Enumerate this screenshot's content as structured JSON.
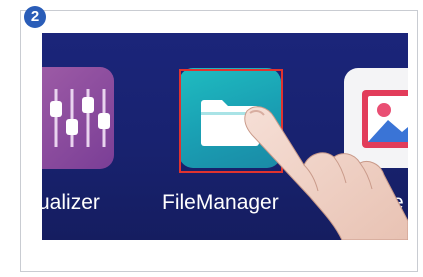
{
  "step": {
    "number": "2"
  },
  "apps": [
    {
      "name": "Equalizer",
      "label": "ualizer",
      "icon": "equalizer-icon"
    },
    {
      "name": "FileManager",
      "label": "FileManager",
      "icon": "folder-icon"
    },
    {
      "name": "Gallery",
      "label": "e",
      "icon": "gallery-icon"
    }
  ],
  "colors": {
    "step_badge": "#2a5db8",
    "screen_background": "#1b257a",
    "highlight_box": "#e0332f",
    "filemanager_icon": "#1fb1bb",
    "equalizer_icon": "#8c4c9f"
  },
  "highlighted_app": "FileManager"
}
